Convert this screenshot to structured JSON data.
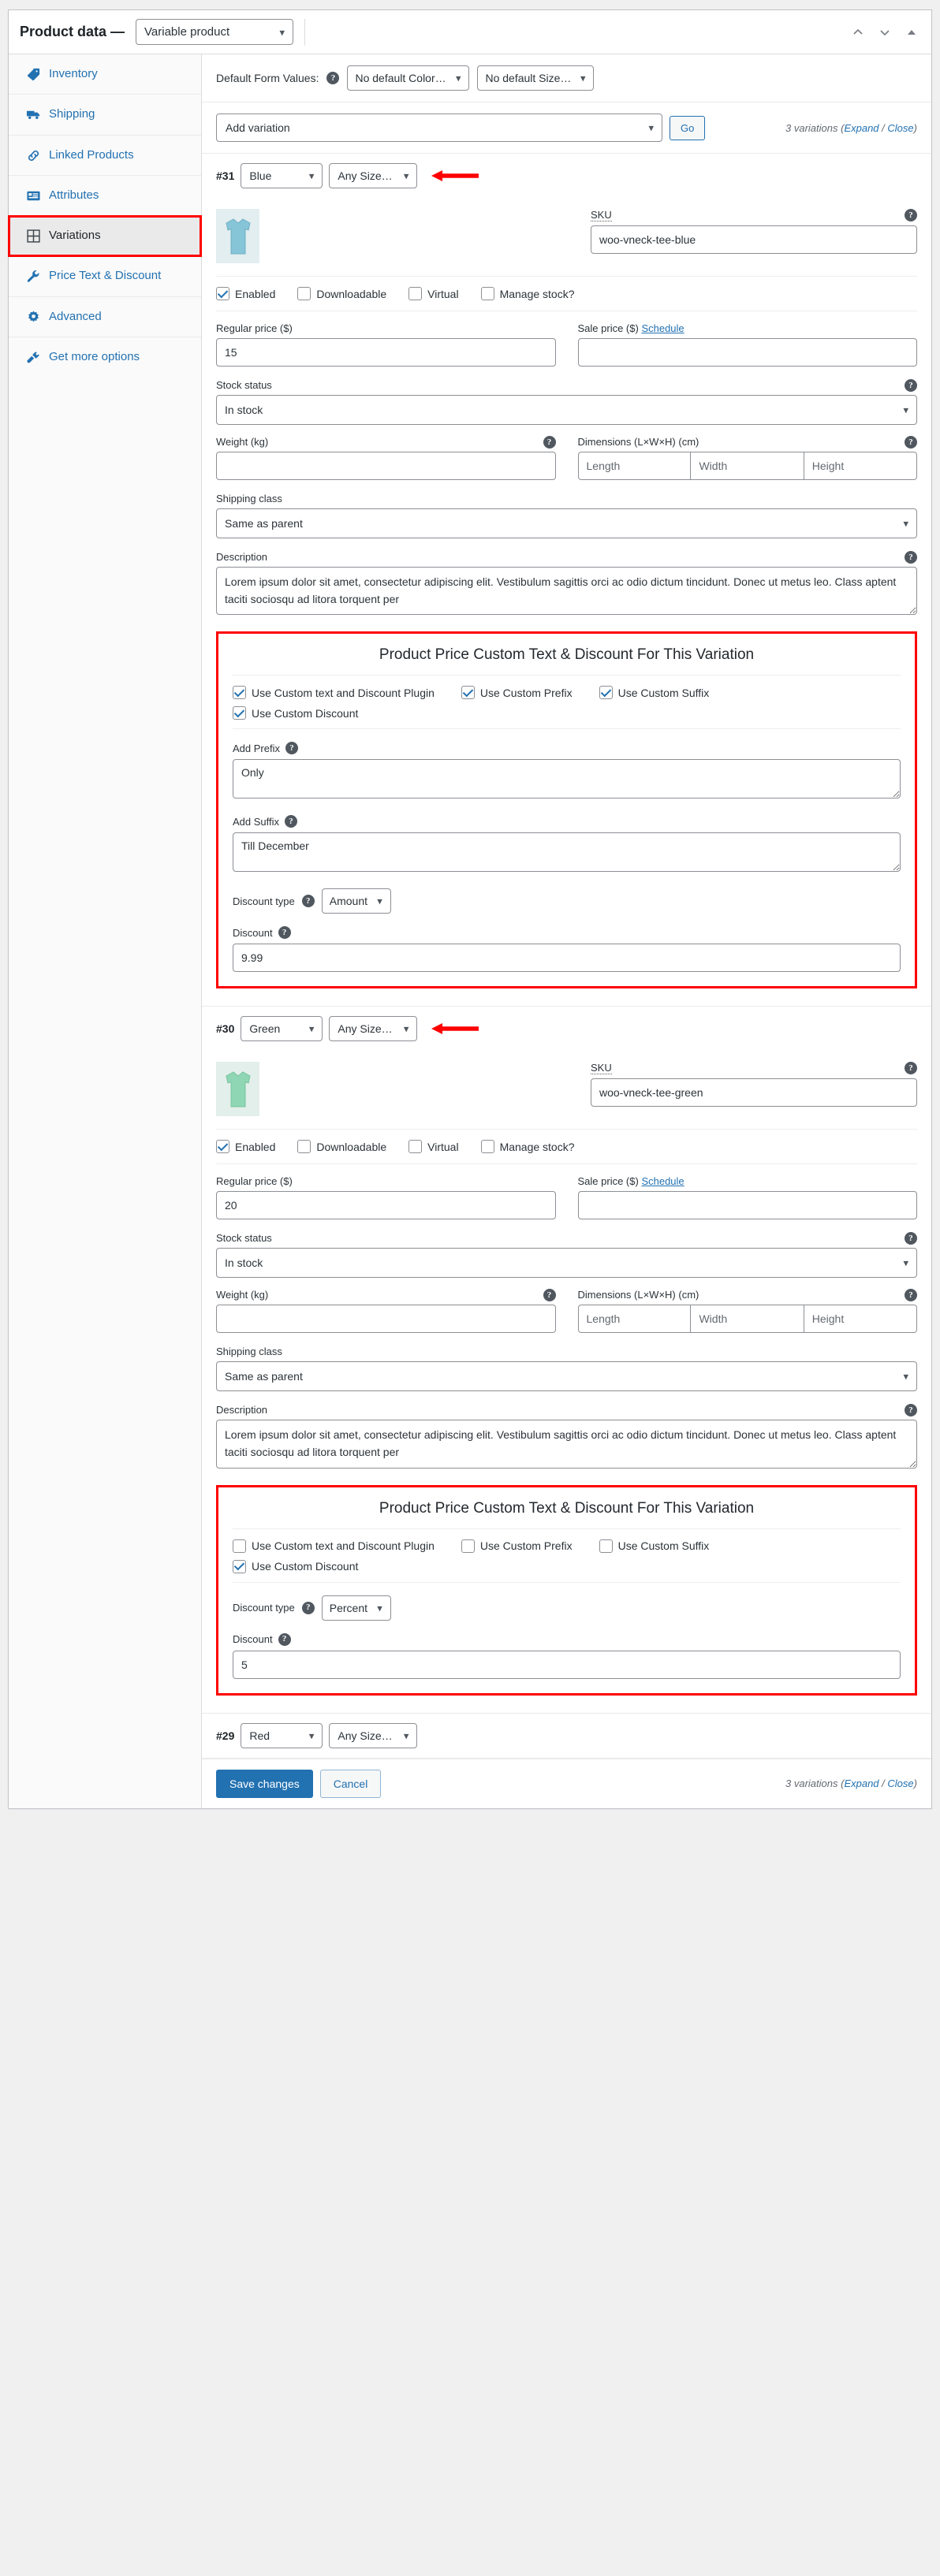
{
  "header": {
    "title": "Product data —",
    "product_type": "Variable product",
    "icons": {
      "up": "chevron-up",
      "down": "chevron-down",
      "collapse": "caret-up"
    }
  },
  "sidebar": {
    "items": [
      {
        "label": "Inventory",
        "icon": "inventory-icon",
        "active": false,
        "highlighted": false
      },
      {
        "label": "Shipping",
        "icon": "shipping-truck-icon",
        "active": false,
        "highlighted": false
      },
      {
        "label": "Linked Products",
        "icon": "link-icon",
        "active": false,
        "highlighted": false
      },
      {
        "label": "Attributes",
        "icon": "attributes-icon",
        "active": false,
        "highlighted": false
      },
      {
        "label": "Variations",
        "icon": "variations-grid-icon",
        "active": true,
        "highlighted": true
      },
      {
        "label": "Price Text & Discount",
        "icon": "wrench-icon",
        "active": false,
        "highlighted": false
      },
      {
        "label": "Advanced",
        "icon": "gear-icon",
        "active": false,
        "highlighted": false
      },
      {
        "label": "Get more options",
        "icon": "plugin-icon",
        "active": false,
        "highlighted": false
      }
    ]
  },
  "toolbar": {
    "default_form_values_label": "Default Form Values:",
    "default_color": "No default Color…",
    "default_size": "No default Size…",
    "add_variation_label": "Add variation",
    "go_label": "Go",
    "variations_count_text": "3 variations",
    "expand_label": "Expand",
    "separator": "/",
    "close_label": "Close"
  },
  "common": {
    "sku_label": "SKU",
    "enabled_label": "Enabled",
    "downloadable_label": "Downloadable",
    "virtual_label": "Virtual",
    "manage_stock_label": "Manage stock?",
    "regular_price_label": "Regular price ($)",
    "sale_price_label": "Sale price ($)",
    "schedule_label": "Schedule",
    "stock_status_label": "Stock status",
    "weight_label": "Weight (kg)",
    "dimensions_label": "Dimensions (L×W×H) (cm)",
    "length_placeholder": "Length",
    "width_placeholder": "Width",
    "height_placeholder": "Height",
    "shipping_class_label": "Shipping class",
    "description_label": "Description",
    "help_glyph": "?"
  },
  "discount_panel_labels": {
    "title": "Product Price Custom Text & Discount For This Variation",
    "use_plugin": "Use Custom text and Discount Plugin",
    "use_prefix": "Use Custom Prefix",
    "use_suffix": "Use Custom Suffix",
    "use_discount": "Use Custom Discount",
    "add_prefix": "Add Prefix",
    "add_suffix": "Add Suffix",
    "discount_type": "Discount type",
    "discount": "Discount"
  },
  "variations": [
    {
      "id": "#31",
      "color": "Blue",
      "size": "Any Size…",
      "has_arrow": true,
      "thumb_color": "#86c5d8",
      "thumb_bg": "#e3eef0",
      "sku": "woo-vneck-tee-blue",
      "enabled": true,
      "downloadable": false,
      "virtual": false,
      "manage_stock": false,
      "regular_price": "15",
      "sale_price": "",
      "stock_status": "In stock",
      "weight": "",
      "length": "",
      "width": "",
      "height": "",
      "shipping_class": "Same as parent",
      "description": "Lorem ipsum dolor sit amet, consectetur adipiscing elit. Vestibulum sagittis orci ac odio dictum tincidunt. Donec ut metus leo. Class aptent taciti sociosqu ad litora torquent per",
      "discount_panel": {
        "use_plugin": true,
        "use_prefix": true,
        "use_suffix": true,
        "use_discount": true,
        "show_prefix_field": true,
        "show_suffix_field": true,
        "prefix_value": "Only",
        "suffix_value": "Till December",
        "discount_type": "Amount",
        "discount_value": "9.99"
      }
    },
    {
      "id": "#30",
      "color": "Green",
      "size": "Any Size…",
      "has_arrow": true,
      "thumb_color": "#8fd6b5",
      "thumb_bg": "#e3efea",
      "sku": "woo-vneck-tee-green",
      "enabled": true,
      "downloadable": false,
      "virtual": false,
      "manage_stock": false,
      "regular_price": "20",
      "sale_price": "",
      "stock_status": "In stock",
      "weight": "",
      "length": "",
      "width": "",
      "height": "",
      "shipping_class": "Same as parent",
      "description": "Lorem ipsum dolor sit amet, consectetur adipiscing elit. Vestibulum sagittis orci ac odio dictum tincidunt. Donec ut metus leo. Class aptent taciti sociosqu ad litora torquent per",
      "discount_panel": {
        "use_plugin": false,
        "use_prefix": false,
        "use_suffix": false,
        "use_discount": true,
        "show_prefix_field": false,
        "show_suffix_field": false,
        "prefix_value": "",
        "suffix_value": "",
        "discount_type": "Percent",
        "discount_value": "5"
      }
    },
    {
      "id": "#29",
      "color": "Red",
      "size": "Any Size…",
      "has_arrow": false,
      "collapsed": true
    }
  ],
  "footer": {
    "save_label": "Save changes",
    "cancel_label": "Cancel",
    "variations_count_text": "3 variations",
    "expand_label": "Expand",
    "separator": "/",
    "close_label": "Close"
  }
}
